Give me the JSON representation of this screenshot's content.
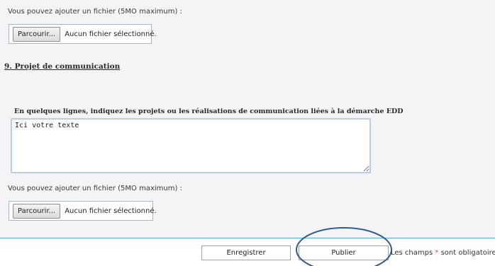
{
  "upload_hint_1": "Vous pouvez ajouter un fichier (5MO maximum) :",
  "file_input_1": {
    "browse_label": "Parcourir...",
    "status": "Aucun fichier sélectionné."
  },
  "section": {
    "heading": "9.  Projet de communication",
    "field_label": "En quelques lignes, indiquez les projets ou les réalisations de communication liées à la démarche EDD",
    "textarea_value": "Ici votre texte"
  },
  "upload_hint_2": "Vous pouvez ajouter un fichier (5MO maximum) :",
  "file_input_2": {
    "browse_label": "Parcourir...",
    "status": "Aucun fichier sélectionné."
  },
  "footer": {
    "save_label": "Enregistrer",
    "publish_label": "Publier",
    "required_prefix": "Les champs",
    "required_star": "*",
    "required_suffix": "sont obligatoires!"
  },
  "colors": {
    "panel_background": "#f4f4f6",
    "separator": "#5aa7d6",
    "textarea_border": "#b9cde4",
    "highlight_ellipse": "#2f5c8f",
    "required_star": "#d9534f"
  }
}
